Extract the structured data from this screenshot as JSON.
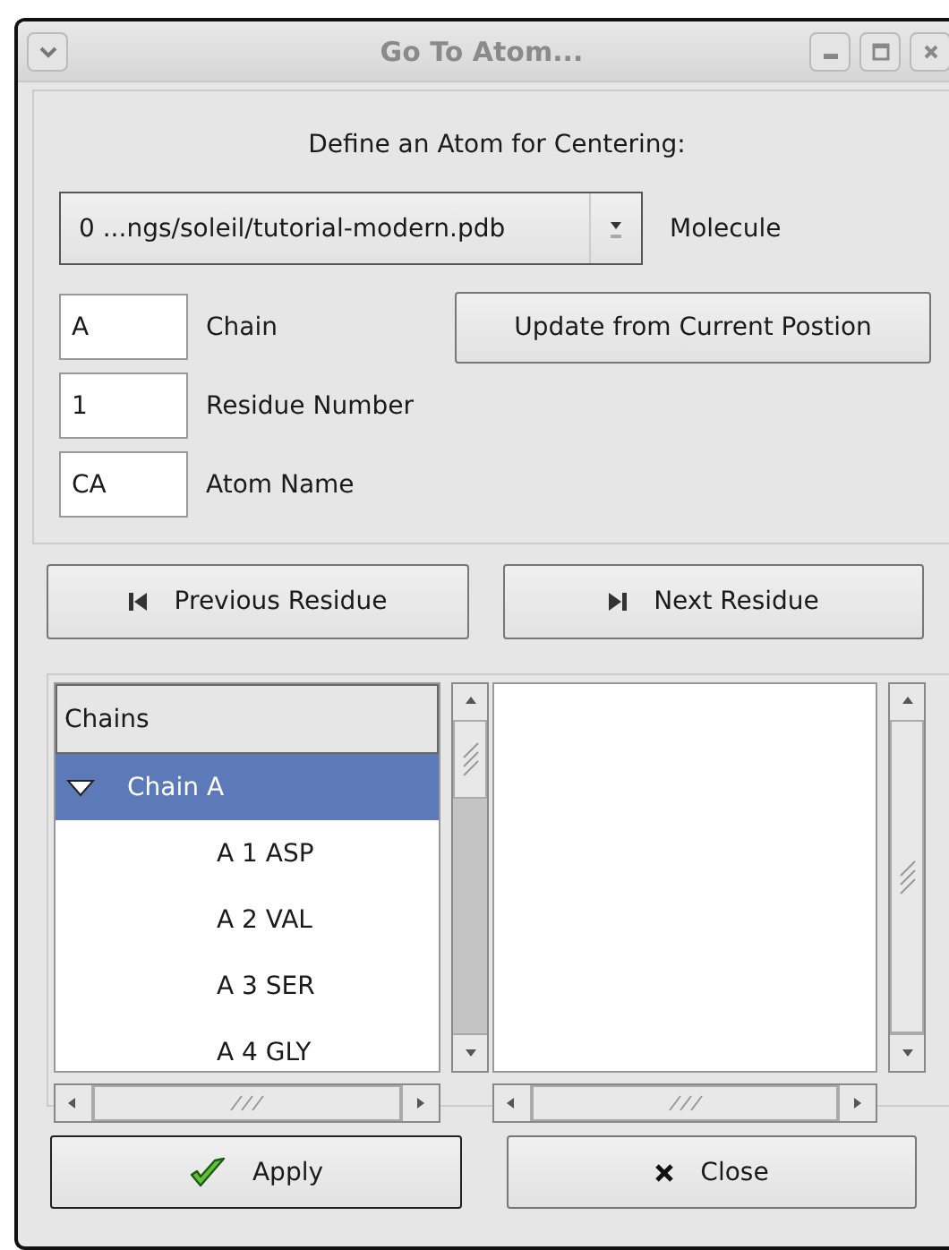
{
  "window": {
    "title": "Go To Atom..."
  },
  "heading": "Define an Atom for Centering:",
  "molecule": {
    "value": "0 ...ngs/soleil/tutorial-modern.pdb",
    "label": "Molecule"
  },
  "fields": [
    {
      "value": "A",
      "label": "Chain"
    },
    {
      "value": "1",
      "label": "Residue Number"
    },
    {
      "value": "CA",
      "label": "Atom Name"
    }
  ],
  "update_button": "Update from Current Postion",
  "nav_buttons": [
    {
      "kind": "previous",
      "label": "Previous Residue"
    },
    {
      "kind": "next",
      "label": "Next Residue"
    }
  ],
  "tree": {
    "column": "Chains",
    "items": [
      {
        "label": "Chain A",
        "expanded": true,
        "selected": true,
        "children": [
          {
            "label": "A 1 ASP",
            "selected": false
          },
          {
            "label": "A 2 VAL",
            "selected": false
          },
          {
            "label": "A 3 SER",
            "selected": false
          },
          {
            "label": "A 4 GLY",
            "selected": false
          }
        ]
      }
    ]
  },
  "buttons": [
    {
      "kind": "apply",
      "label": "Apply"
    },
    {
      "kind": "close",
      "label": "Close"
    }
  ]
}
